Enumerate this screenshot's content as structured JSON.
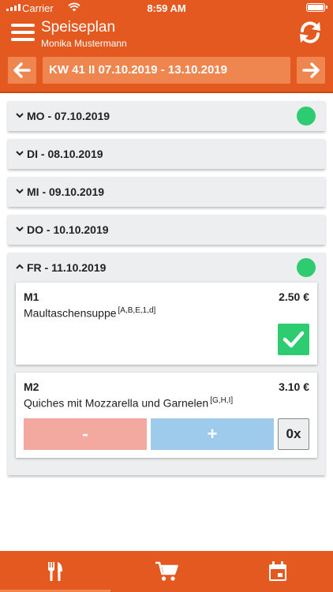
{
  "status_bar": {
    "carrier": "Carrier",
    "time": "8:59 AM"
  },
  "header": {
    "title": "Speiseplan",
    "subtitle": "Monika Mustermann"
  },
  "week": {
    "label": "KW 41 II 07.10.2019 - 13.10.2019"
  },
  "days": [
    {
      "label": "MO - 07.10.2019",
      "expanded": false,
      "ordered": true
    },
    {
      "label": "DI - 08.10.2019",
      "expanded": false,
      "ordered": false
    },
    {
      "label": "MI - 09.10.2019",
      "expanded": false,
      "ordered": false
    },
    {
      "label": "DO - 10.10.2019",
      "expanded": false,
      "ordered": false
    },
    {
      "label": "FR - 11.10.2019",
      "expanded": true,
      "ordered": true
    }
  ],
  "meals": [
    {
      "code": "M1",
      "price": "2.50 €",
      "name": "Maultaschensuppe",
      "allergens": "[A,B,E,1,d]",
      "selected": true
    },
    {
      "code": "M2",
      "price": "3.10 €",
      "name": "Quiches mit Mozzarella und Garnelen",
      "allergens": "[G,H,I]",
      "selected": false,
      "minus_label": "-",
      "plus_label": "+",
      "quantity": "0x"
    }
  ],
  "tabs": [
    {
      "icon": "cutlery-icon",
      "active": true
    },
    {
      "icon": "cart-icon",
      "active": false
    },
    {
      "icon": "calendar-icon",
      "active": false
    }
  ],
  "colors": {
    "primary": "#e4591f",
    "primary_light": "#ef8650",
    "success": "#2ecc71",
    "minus": "#f4a9a0",
    "plus": "#9ecbec",
    "card": "#eceeef"
  }
}
